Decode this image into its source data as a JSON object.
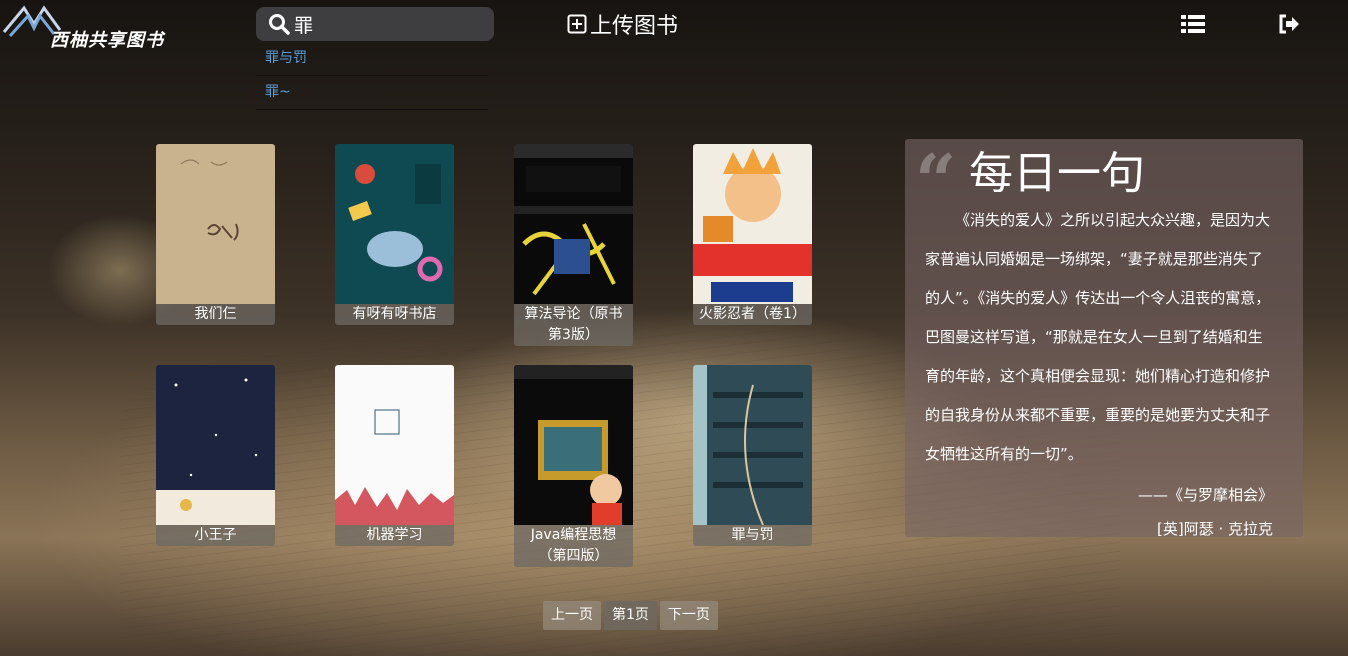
{
  "header": {
    "logo_text": "西柚共享图书",
    "search": {
      "value": "罪",
      "placeholder": ""
    },
    "upload_label": "上传图书",
    "icons": {
      "search": "search-icon",
      "upload": "plus-square-icon",
      "menu": "list-icon",
      "logout": "sign-out-icon"
    }
  },
  "suggestions": [
    {
      "label": "罪与罚"
    },
    {
      "label": "罪~"
    }
  ],
  "books": [
    {
      "title": "我们仨"
    },
    {
      "title": "有呀有呀书店"
    },
    {
      "title": "算法导论（原书第3版）"
    },
    {
      "title": "火影忍者（卷1）"
    },
    {
      "title": "小王子"
    },
    {
      "title": "机器学习"
    },
    {
      "title": "Java编程思想（第四版）"
    },
    {
      "title": "罪与罚"
    }
  ],
  "quote": {
    "heading": "每日一句",
    "text": "《消失的爱人》之所以引起大众兴趣，是因为大家普遍认同婚姻是一场绑架，“妻子就是那些消失了的人”。《消失的爱人》传达出一个令人沮丧的寓意，巴图曼这样写道，“那就是在女人一旦到了结婚和生育的年龄，这个真相便会显现：她们精心打造和修护的自我身份从来都不重要，重要的是她要为丈夫和子女牺牲这所有的一切”。",
    "source": "——《与罗摩相会》",
    "author": "[英]阿瑟 · 克拉克"
  },
  "pagination": {
    "prev": "上一页",
    "current": "第1页",
    "next": "下一页"
  },
  "colors": {
    "suggestion_link": "#5b9bd5",
    "search_bg": "#3e3e40",
    "quote_bg": "rgba(120,100,100,0.62)"
  }
}
